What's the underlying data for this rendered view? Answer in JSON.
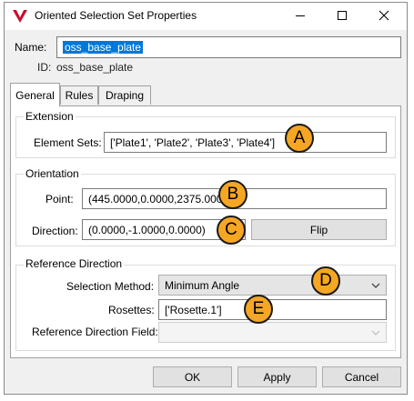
{
  "window": {
    "title": "Oriented Selection Set Properties",
    "min_glyph": "—",
    "max_glyph": "☐",
    "close_glyph": "✕"
  },
  "header": {
    "name_label": "Name:",
    "name_value": "oss_base_plate",
    "id_label": "ID:",
    "id_value": "oss_base_plate"
  },
  "tabs": [
    {
      "label": "General",
      "active": true
    },
    {
      "label": "Rules",
      "active": false
    },
    {
      "label": "Draping",
      "active": false
    }
  ],
  "extension": {
    "title": "Extension",
    "element_sets_label": "Element Sets:",
    "element_sets_value": "['Plate1', 'Plate2', 'Plate3', 'Plate4']"
  },
  "orientation": {
    "title": "Orientation",
    "point_label": "Point:",
    "point_value": "(445.0000,0.0000,2375.0000)",
    "direction_label": "Direction:",
    "direction_value": "(0.0000,-1.0000,0.0000)",
    "flip_label": "Flip"
  },
  "reference_direction": {
    "title": "Reference Direction",
    "selection_method_label": "Selection Method:",
    "selection_method_value": "Minimum Angle",
    "rosettes_label": "Rosettes:",
    "rosettes_value": "['Rosette.1']",
    "ref_dir_field_label": "Reference Direction Field:",
    "ref_dir_field_value": ""
  },
  "footer": {
    "ok_label": "OK",
    "apply_label": "Apply",
    "cancel_label": "Cancel"
  },
  "callouts": {
    "a": "A",
    "b": "B",
    "c": "C",
    "d": "D",
    "e": "E",
    "color": "#f5a623"
  },
  "colors": {
    "selection_highlight": "#0078d7",
    "app_icon_red": "#c8102e"
  },
  "icons": [
    "app-logo-icon",
    "minimize-icon",
    "maximize-icon",
    "close-icon",
    "chevron-down-icon"
  ]
}
